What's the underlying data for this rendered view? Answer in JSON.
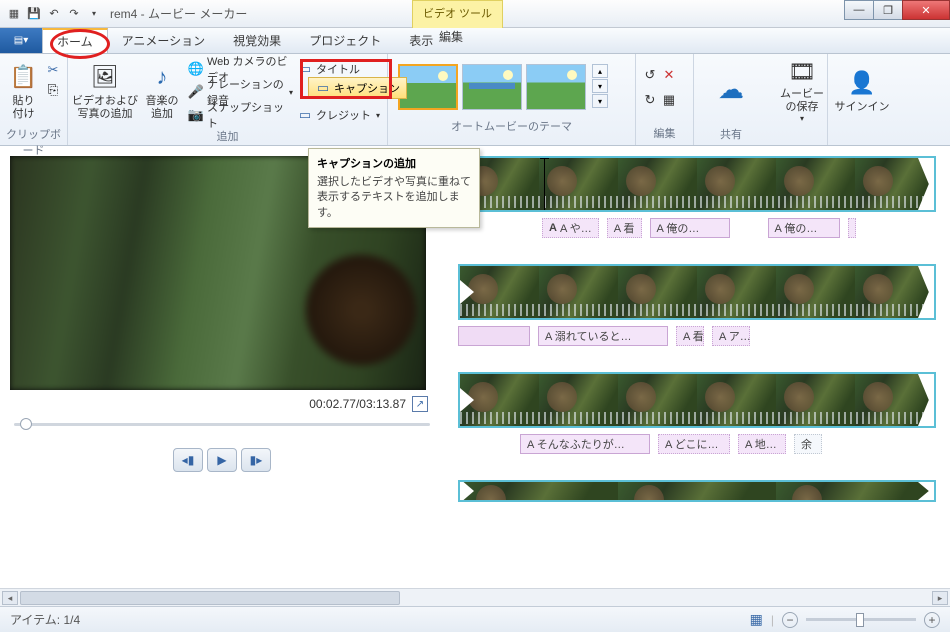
{
  "title": "rem4 - ムービー メーカー",
  "videoToolsTab": "ビデオ ツール",
  "winControls": {
    "min": "—",
    "max": "❐",
    "close": "✕"
  },
  "fileMenu": "▤▾",
  "tabs": {
    "home": "ホーム",
    "animation": "アニメーション",
    "visualfx": "視覚効果",
    "project": "プロジェクト",
    "view": "表示",
    "edit": "編集"
  },
  "ribbon": {
    "clipboard": {
      "paste": "貼り\n付け",
      "label": "クリップボード"
    },
    "add": {
      "videoPhoto": "ビデオおよび\n写真の追加",
      "music": "音楽の\n追加",
      "webcam": "Web カメラのビデオ",
      "narration": "ナレーションの録音",
      "snapshot": "スナップショット",
      "title": "タイトル",
      "caption": "キャプション",
      "credit": "クレジット",
      "label": "追加"
    },
    "themes": {
      "label": "オートムービーのテーマ"
    },
    "edit": {
      "label": "編集"
    },
    "share": {
      "saveMovie": "ムービー\nの保存",
      "signin": "サインイン",
      "label": "共有"
    }
  },
  "tooltip": {
    "title": "キャプションの追加",
    "body": "選択したビデオや写真に重ねて表示するテキストを追加します。"
  },
  "preview": {
    "time": "00:02.77/03:13.87"
  },
  "captions": {
    "r1": [
      "A や…",
      "A 看",
      "A 俺の…",
      "A 俺の…"
    ],
    "r2": [
      "",
      "A 溺れていると…",
      "A 看",
      "A ア…"
    ],
    "r3": [
      "A そんなふたりが…",
      "A どこに…",
      "A 地…",
      "余"
    ]
  },
  "status": {
    "items": "アイテム: 1/4"
  },
  "zoom": {
    "minus": "−",
    "plus": "+"
  }
}
